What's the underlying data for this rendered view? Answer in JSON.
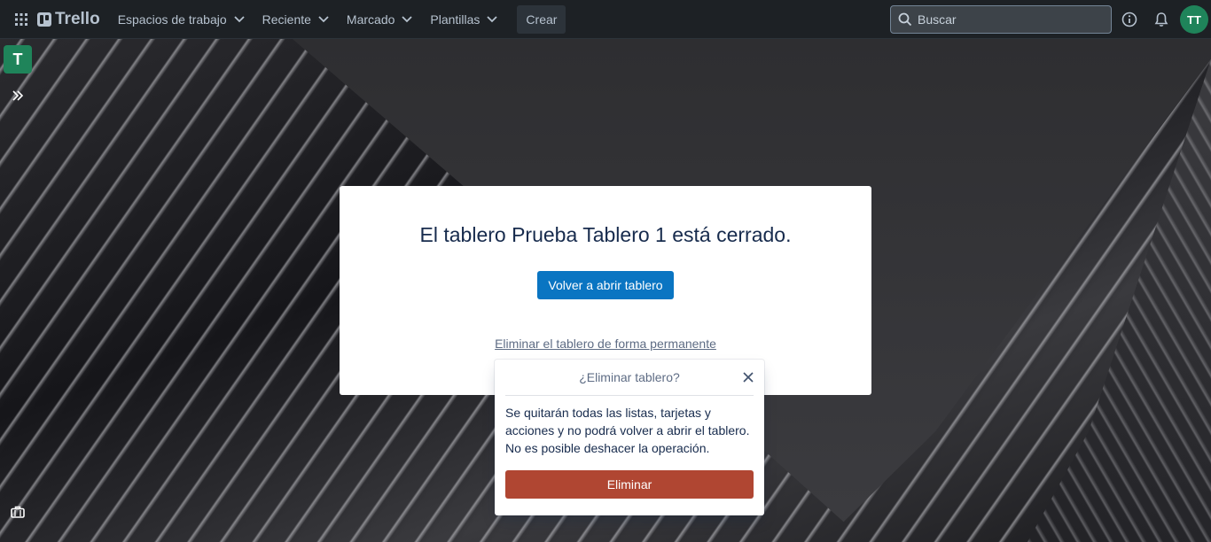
{
  "header": {
    "logo_text": "Trello",
    "nav": [
      {
        "label": "Espacios de trabajo"
      },
      {
        "label": "Reciente"
      },
      {
        "label": "Marcado"
      },
      {
        "label": "Plantillas"
      }
    ],
    "create_label": "Crear",
    "search_placeholder": "Buscar",
    "avatar_initials": "TT"
  },
  "sidebar": {
    "workspace_initial": "T"
  },
  "closed_board": {
    "title": "El tablero Prueba Tablero 1 está cerrado.",
    "reopen_label": "Volver a abrir tablero",
    "delete_link": "Eliminar el tablero de forma permanente"
  },
  "delete_popover": {
    "title": "¿Eliminar tablero?",
    "body": "Se quitarán todas las listas, tarjetas y acciones y no podrá volver a abrir el tablero. No es posible deshacer la operación.",
    "confirm_label": "Eliminar"
  },
  "colors": {
    "header_bg": "#1d2125",
    "avatar_bg": "#1f845a",
    "primary_button": "#0a75c2",
    "danger_button": "#b04632"
  },
  "icons": [
    "apps-grid-icon",
    "trello-logo-icon",
    "chevron-down-icon",
    "search-icon",
    "info-icon",
    "bell-icon",
    "expand-sidebar-icon",
    "briefcase-icon",
    "close-icon"
  ]
}
